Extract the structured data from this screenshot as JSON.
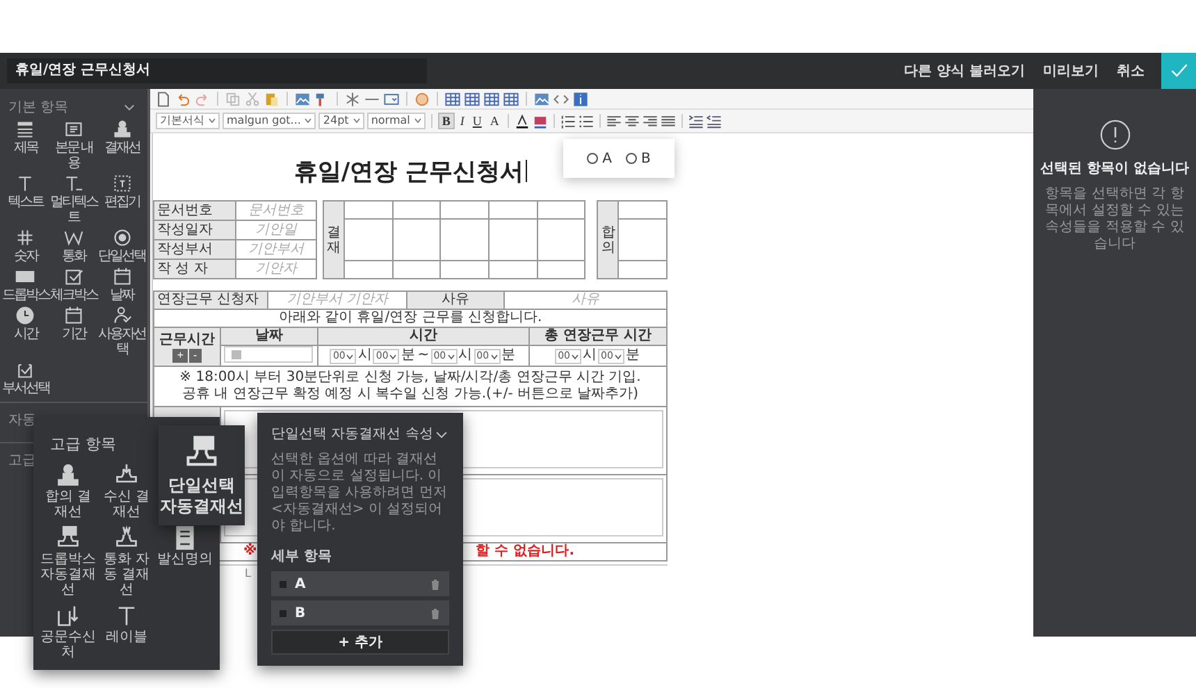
{
  "header": {
    "title": "휴일/연장 근무신청서",
    "links": [
      "다른 양식 불러오기",
      "미리보기",
      "취소"
    ]
  },
  "sidebar": {
    "title": "기본 항목",
    "expanded": true,
    "items": [
      {
        "label": "제목"
      },
      {
        "label": "본문 내용"
      },
      {
        "label": "결재선"
      },
      {
        "label": "텍스트"
      },
      {
        "label": "멀티텍스트"
      },
      {
        "label": "편집기"
      },
      {
        "label": "숫자"
      },
      {
        "label": "통화"
      },
      {
        "label": "단일선택"
      },
      {
        "label": "드롭박스"
      },
      {
        "label": "체크박스"
      },
      {
        "label": "날짜"
      },
      {
        "label": "시간"
      },
      {
        "label": "기간"
      },
      {
        "label": "사용자선택"
      },
      {
        "label": "부서선택"
      }
    ],
    "sections": [
      "자동",
      "고급"
    ]
  },
  "toolbar": {
    "selects": [
      "기본서식",
      "malgun got...",
      "24pt",
      "normal"
    ],
    "format_buttons": [
      "B",
      "I",
      "U",
      "A"
    ]
  },
  "document": {
    "title": "휴일/연장 근무신청서",
    "info_rows": [
      {
        "label": "문서번호",
        "placeholder": "문서번호"
      },
      {
        "label": "작성일자",
        "placeholder": "기안일"
      },
      {
        "label": "작성부서",
        "placeholder": "기안부서"
      },
      {
        "label": "작 성 자",
        "placeholder": "기안자"
      }
    ],
    "approval_label": "결재",
    "agreement_label": "합의",
    "applicant": {
      "label": "연장근무 신청자",
      "dept_placeholder": "기안부서",
      "name_placeholder": "기안자",
      "reason_label": "사유",
      "reason_placeholder": "사유"
    },
    "intro": "아래와 같이 휴일/연장 근무를 신청합니다.",
    "time_headers": [
      "근무시간",
      "날짜",
      "시간",
      "총 연장근무 시간"
    ],
    "add_label": "+",
    "remove_label": "-",
    "start": [
      {
        "value": "00",
        "unit": "시"
      },
      {
        "value": "00",
        "unit": "분"
      }
    ],
    "separator": "~",
    "end": [
      {
        "value": "00",
        "unit": "시"
      },
      {
        "value": "00",
        "unit": "분"
      }
    ],
    "total": [
      {
        "value": "00",
        "unit": "시"
      },
      {
        "value": "00",
        "unit": "분"
      }
    ],
    "notes": [
      "※ 18:00시 부터 30분단위로 신청 가능, 날짜/시각/총 연장근무 시간 기입.",
      "공휴 내 연장근무 확정 예정 시 복수일 신청 가능.(+/- 버튼으로 날짜추가)"
    ],
    "warning": {
      "left": "※",
      "right": "할 수 없습니다."
    }
  },
  "status_tab": "L",
  "radio_popup": {
    "options": [
      {
        "label": "A",
        "selected": false
      },
      {
        "label": "B",
        "selected": false
      }
    ]
  },
  "advanced_panel": {
    "title": "고급 항목",
    "items": [
      {
        "label": "합의 결재선"
      },
      {
        "label": "수신 결재선"
      },
      {
        "label": "드롭박스 자동결재선"
      },
      {
        "label": "통화 자동 결재선"
      },
      {
        "label": "발신명의"
      },
      {
        "label": "공문수신처"
      },
      {
        "label": "레이블"
      }
    ]
  },
  "drag_tile": {
    "label": "단일선택 자동결재선"
  },
  "property_panel": {
    "title": "단일선택 자동결재선 속성",
    "expanded": true,
    "description": "선택한 옵션에 따라 결재선이 자동으로 설정됩니다. 이 입력항목을 사용하려면 먼저 <자동결재선> 이 설정되어야 합니다.",
    "section": "세부 항목",
    "options": [
      "A",
      "B"
    ],
    "add": "+ 추가"
  },
  "right_panel": {
    "title": "선택된 항목이 없습니다",
    "description": "항목을 선택하면 각 항목에서 설정할 수 있는 속성들을 적용할 수 있습니다"
  }
}
